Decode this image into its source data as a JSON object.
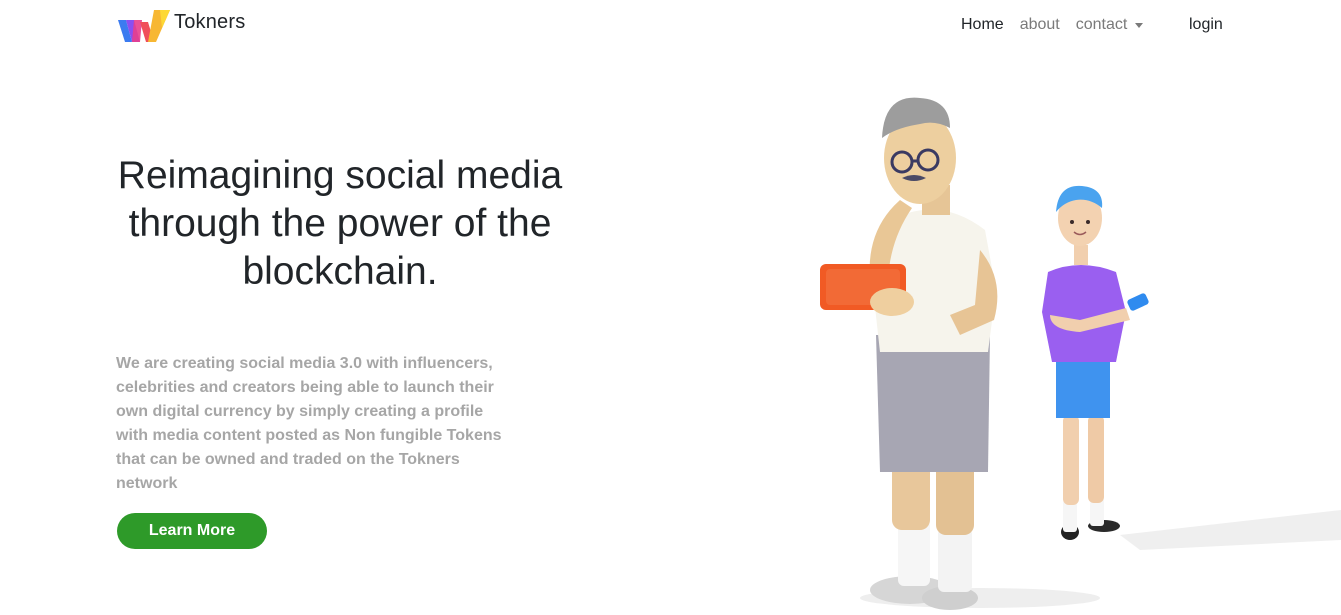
{
  "brand": {
    "name": "Tokners",
    "logo_icon": "w-logo-icon"
  },
  "nav": {
    "items": [
      {
        "label": "Home",
        "active": true
      },
      {
        "label": "about",
        "active": false
      },
      {
        "label": "contact",
        "active": false,
        "dropdown": true
      }
    ],
    "login_label": "login"
  },
  "hero": {
    "title": "Reimagining social media through the power of the blockchain.",
    "description": "We are creating social media 3.0 with influencers, celebrities and creators being able to launch their own digital currency by simply creating a profile with media content posted as Non fungible Tokens that can be owned and traded on the Tokners network",
    "cta_label": "Learn More"
  },
  "colors": {
    "cta_background": "#2e9a29",
    "title_text": "#212529",
    "description_text": "#a6a6a6",
    "nav_muted": "#7a7a7a"
  }
}
